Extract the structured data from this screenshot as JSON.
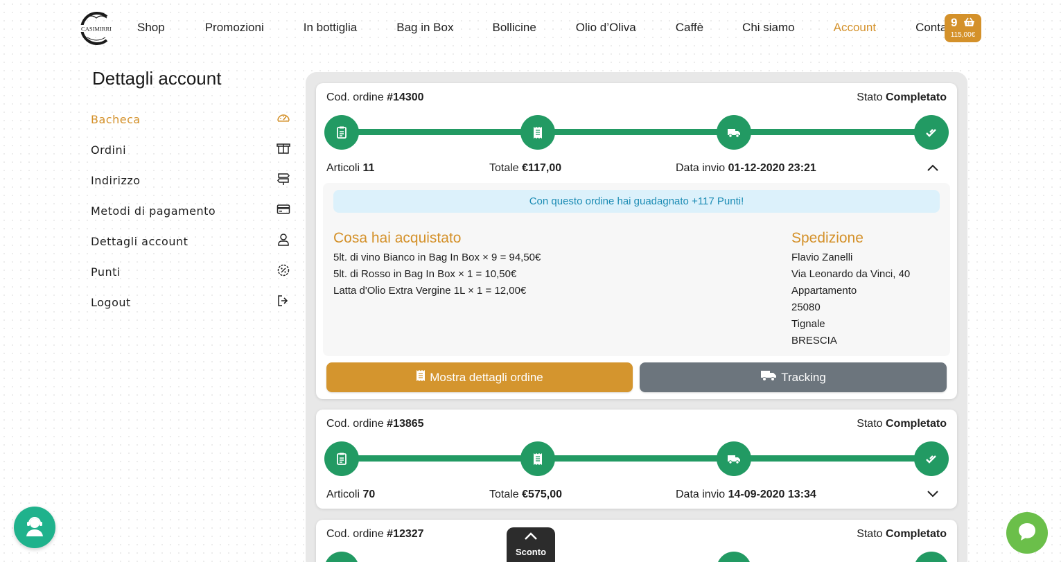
{
  "brand": {
    "name": "CASIMIRRI",
    "accent": "#d4912a",
    "green": "#229a63"
  },
  "nav": {
    "items": [
      {
        "label": "Shop"
      },
      {
        "label": "Promozioni"
      },
      {
        "label": "In bottiglia"
      },
      {
        "label": "Bag in Box"
      },
      {
        "label": "Bollicine"
      },
      {
        "label": "Olio d’Oliva"
      },
      {
        "label": "Caffè"
      },
      {
        "label": "Chi siamo"
      },
      {
        "label": "Account",
        "active": true
      },
      {
        "label": "Contatti"
      }
    ],
    "cart": {
      "count": "9",
      "total": "115,00€",
      "icon": "basket-icon"
    }
  },
  "sidebar": {
    "title": "Dettagli account",
    "items": [
      {
        "label": "Bacheca",
        "icon": "dashboard-icon",
        "active": true
      },
      {
        "label": "Ordini",
        "icon": "box-icon"
      },
      {
        "label": "Indirizzo",
        "icon": "signpost-icon"
      },
      {
        "label": "Metodi di pagamento",
        "icon": "credit-card-icon"
      },
      {
        "label": "Dettagli account",
        "icon": "user-icon"
      },
      {
        "label": "Punti",
        "icon": "points-icon"
      },
      {
        "label": "Logout",
        "icon": "logout-icon"
      }
    ]
  },
  "orders": [
    {
      "code_label": "Cod. ordine",
      "code": "#14300",
      "status_label": "Stato",
      "status": "Completato",
      "items_label": "Articoli",
      "items": "11",
      "total_label": "Totale",
      "total": "€117,00",
      "date_label": "Data invio",
      "date": "01-12-2020 23:21",
      "expanded": true,
      "points_banner": "Con questo ordine hai guadagnato +117 Punti!",
      "purchased_title": "Cosa hai acquistato",
      "purchased": [
        "5lt. di vino Bianco in Bag In Box × 9 = 94,50€",
        "5lt. di Rosso in Bag In Box × 1 = 10,50€",
        "Latta d'Olio Extra Vergine 1L × 1 = 12,00€"
      ],
      "shipping_title": "Spedizione",
      "shipping": [
        "Flavio Zanelli",
        "Via Leonardo da Vinci, 40",
        "Appartamento",
        "25080",
        "Tignale",
        "BRESCIA"
      ],
      "btn_details": "Mostra dettagli ordine",
      "btn_tracking": "Tracking"
    },
    {
      "code_label": "Cod. ordine",
      "code": "#13865",
      "status_label": "Stato",
      "status": "Completato",
      "items_label": "Articoli",
      "items": "70",
      "total_label": "Totale",
      "total": "€575,00",
      "date_label": "Data invio",
      "date": "14-09-2020 13:34",
      "expanded": false
    },
    {
      "code_label": "Cod. ordine",
      "code": "#12327",
      "status_label": "Stato",
      "status": "Completato"
    }
  ],
  "floating": {
    "sconto": "Sconto"
  }
}
